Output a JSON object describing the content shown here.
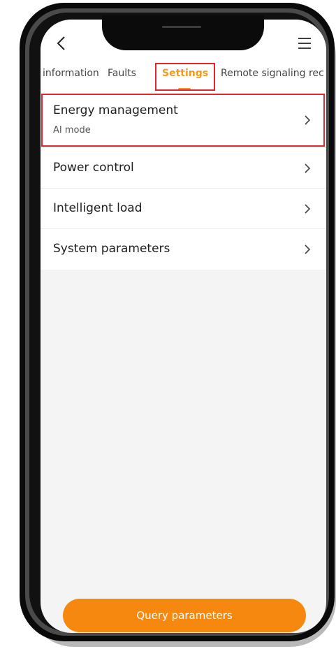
{
  "nav": {
    "back_icon": "chevron-left-icon",
    "menu_icon": "hamburger-menu-icon"
  },
  "tabs": [
    {
      "label": "information"
    },
    {
      "label": "Faults"
    },
    {
      "label": "Settings"
    },
    {
      "label": "Remote signaling rec"
    }
  ],
  "active_tab": "Settings",
  "settings_list": [
    {
      "title": "Energy management",
      "subtitle": "AI mode"
    },
    {
      "title": "Power control"
    },
    {
      "title": "Intelligent load"
    },
    {
      "title": "System parameters"
    }
  ],
  "footer": {
    "query_button_label": "Query parameters"
  },
  "colors": {
    "accent": "#f6880f",
    "tab_active": "#f39a1e",
    "highlight": "#e0262f"
  }
}
